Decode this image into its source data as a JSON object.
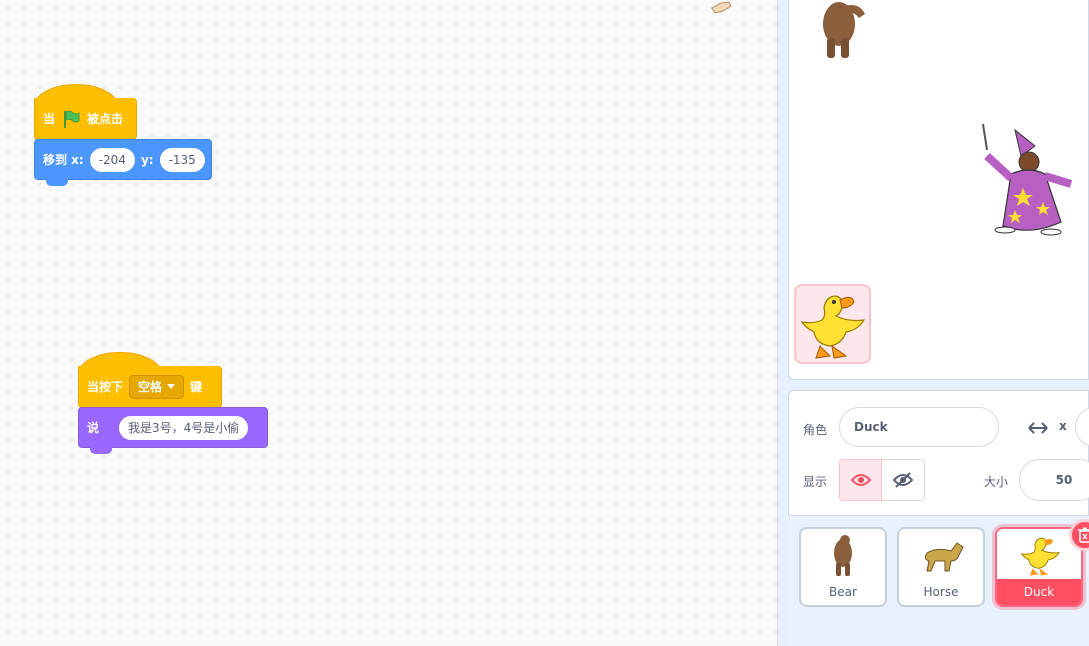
{
  "workspace": {
    "script1": {
      "hat_when": "当",
      "hat_clicked": "被点击",
      "goto_label": "移到 x:",
      "x_value": "-204",
      "y_label": "y:",
      "y_value": "-135"
    },
    "script2": {
      "hat_when_pressed": "当按下",
      "key_option": "空格",
      "hat_key": "键",
      "say_label": "说",
      "say_text": "我是3号，4号是小偷"
    }
  },
  "sprite_info": {
    "sprite_label": "角色",
    "sprite_name": "Duck",
    "x_label": "x",
    "show_label": "显示",
    "size_label": "大小",
    "size_value": "50"
  },
  "sprites": [
    {
      "name": "Bear",
      "selected": false
    },
    {
      "name": "Horse",
      "selected": false
    },
    {
      "name": "Duck",
      "selected": true
    }
  ],
  "colors": {
    "events": "#ffbf00",
    "motion": "#4c97ff",
    "looks": "#9966ff",
    "selected": "#ff4d61"
  }
}
